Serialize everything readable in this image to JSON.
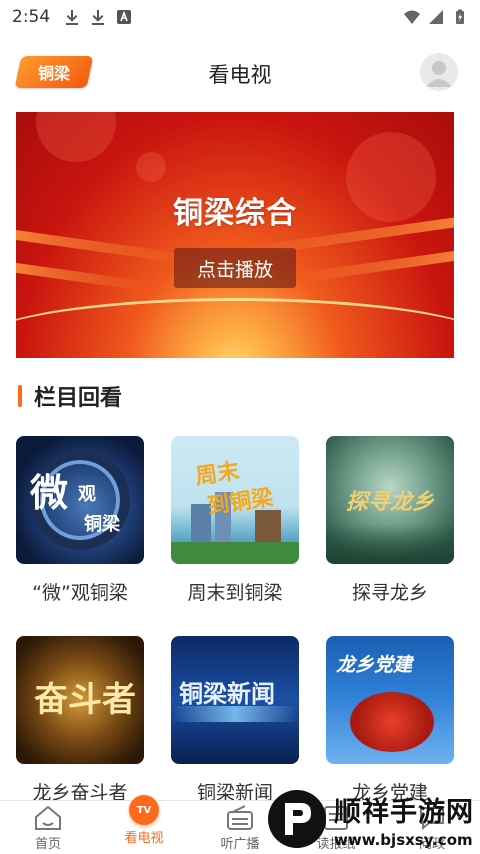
{
  "status_bar": {
    "time": "2:54"
  },
  "header": {
    "logo_text": "铜梁",
    "title": "看电视"
  },
  "banner": {
    "title": "铜梁综合",
    "play_label": "点击播放"
  },
  "section": {
    "title": "栏目回看"
  },
  "programs": [
    {
      "label": "“微”观铜梁",
      "thumb_text": "微观铜梁"
    },
    {
      "label": "周末到铜梁",
      "thumb_text": "周末到铜梁"
    },
    {
      "label": "探寻龙乡",
      "thumb_text": "探寻龙乡"
    },
    {
      "label": "龙乡奋斗者",
      "thumb_text": "奋斗者"
    },
    {
      "label": "铜梁新闻",
      "thumb_text": "铜梁新闻"
    },
    {
      "label": "龙乡党建",
      "thumb_text": "龙乡党建"
    }
  ],
  "tabs": [
    {
      "label": "首页",
      "icon": "home-icon"
    },
    {
      "label": "看电视",
      "icon": "tv-icon",
      "badge": "TV"
    },
    {
      "label": "听广播",
      "icon": "radio-icon"
    },
    {
      "label": "读报纸",
      "icon": "newspaper-icon"
    },
    {
      "label": "问政",
      "icon": "chat-icon"
    }
  ],
  "watermark": {
    "title": "顺祥手游网",
    "url": "www.bjsxsy.com"
  },
  "colors": {
    "accent": "#ff6a1a",
    "banner_red": "#c9140f"
  }
}
